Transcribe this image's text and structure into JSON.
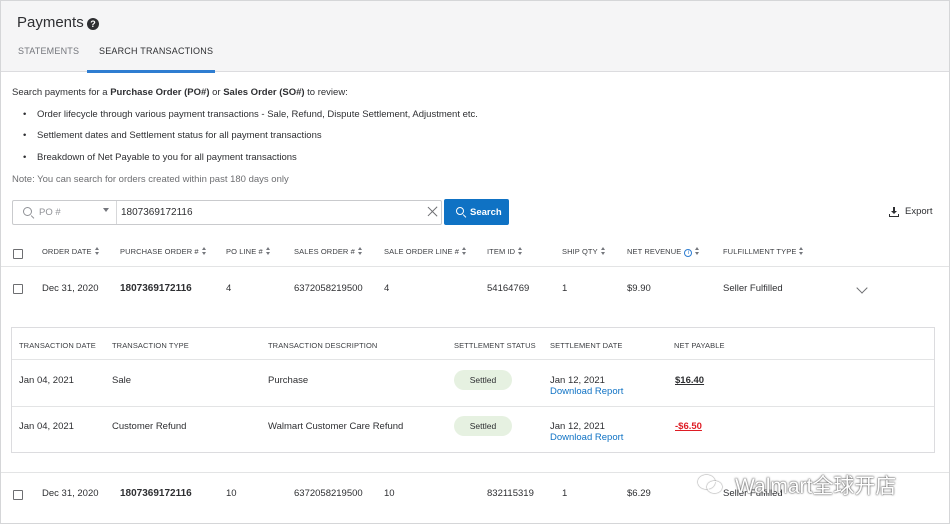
{
  "header": {
    "title": "Payments",
    "tabs": [
      {
        "label": "STATEMENTS",
        "active": false
      },
      {
        "label": "SEARCH TRANSACTIONS",
        "active": true
      }
    ]
  },
  "intro": {
    "prefix": "Search payments for a ",
    "po": "Purchase Order (PO#)",
    "or": " or ",
    "so": "Sales Order (SO#)",
    "suffix": " to review:",
    "bullets": [
      "Order lifecycle through various payment transactions - Sale, Refund, Dispute Settlement, Adjustment etc.",
      "Settlement dates and Settlement status for all payment transactions",
      "Breakdown of Net Payable to you for all payment transactions"
    ],
    "note": "Note: You can search for orders created within past 180 days only"
  },
  "search": {
    "select_value": "PO #",
    "value": "1807369172116",
    "button_label": "Search",
    "export_label": "Export"
  },
  "colors": {
    "accent": "#0f72c4",
    "badge_bg": "#e6f1e1",
    "negative": "#de1c24"
  },
  "table": {
    "headers": [
      "ORDER DATE",
      "PURCHASE ORDER #",
      "PO LINE #",
      "SALES ORDER #",
      "SALE ORDER LINE #",
      "ITEM ID",
      "SHIP QTY",
      "NET REVENUE",
      "FULFILLMENT TYPE"
    ],
    "rows": [
      {
        "order_date": "Dec 31, 2020",
        "po": "1807369172116",
        "po_line": "4",
        "so": "6372058219500",
        "so_line": "4",
        "item_id": "54164769",
        "ship_qty": "1",
        "net_revenue": "$9.90",
        "fulfillment": "Seller Fulfilled"
      },
      {
        "order_date": "Dec 31, 2020",
        "po": "1807369172116",
        "po_line": "10",
        "so": "6372058219500",
        "so_line": "10",
        "item_id": "832115319",
        "ship_qty": "1",
        "net_revenue": "$6.29",
        "fulfillment": "Seller Fulfilled"
      }
    ]
  },
  "transactions": {
    "headers": [
      "TRANSACTION DATE",
      "TRANSACTION TYPE",
      "TRANSACTION DESCRIPTION",
      "SETTLEMENT STATUS",
      "SETTLEMENT DATE",
      "NET PAYABLE"
    ],
    "rows": [
      {
        "date": "Jan 04, 2021",
        "type": "Sale",
        "description": "Purchase",
        "status": "Settled",
        "settlement_date": "Jan 12, 2021",
        "report_link": "Download Report",
        "net_payable": "$16.40"
      },
      {
        "date": "Jan 04, 2021",
        "type": "Customer Refund",
        "description": "Walmart Customer Care Refund",
        "status": "Settled",
        "settlement_date": "Jan 12, 2021",
        "report_link": "Download Report",
        "net_payable": "-$6.50"
      }
    ]
  },
  "watermark": {
    "text": "Walmart全球开店",
    "icon": "wechat-icon"
  }
}
